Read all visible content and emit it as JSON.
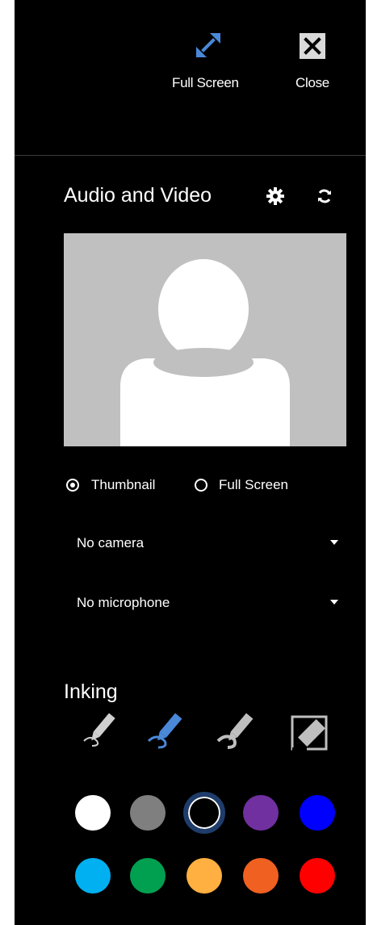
{
  "top": {
    "fullscreen_label": "Full Screen",
    "close_label": "Close",
    "fullscreen_icon": "expand-arrows-icon",
    "close_icon": "close-x-icon"
  },
  "audio_video": {
    "title": "Audio and Video",
    "settings_icon": "gear-icon",
    "refresh_icon": "refresh-icon",
    "view_options": [
      {
        "label": "Thumbnail",
        "selected": true
      },
      {
        "label": "Full Screen",
        "selected": false
      }
    ],
    "camera_select": "No camera",
    "microphone_select": "No microphone"
  },
  "inking": {
    "title": "Inking",
    "tools": [
      "pen-icon",
      "highlighter-icon",
      "pen-erase-icon",
      "eraser-icon"
    ],
    "selected_tool": "highlighter-icon",
    "colors": [
      "#ffffff",
      "#7f7f7f",
      "#000000",
      "#7030a0",
      "#0000ff",
      "#00b0f0",
      "#00a050",
      "#ffb040",
      "#f06020",
      "#ff0000"
    ],
    "selected_color": "#000000",
    "accent_color": "#4a88d8"
  }
}
